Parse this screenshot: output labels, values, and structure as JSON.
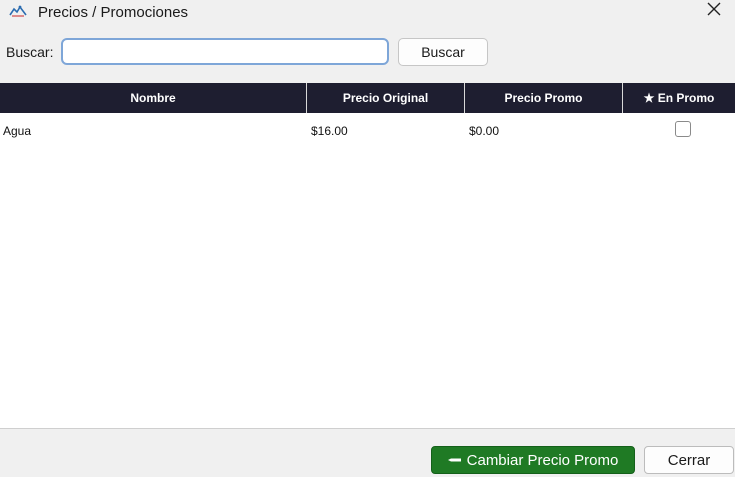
{
  "window": {
    "title": "Precios / Promociones",
    "app_icon": "app-logo-icon",
    "close_icon": "close-icon"
  },
  "search": {
    "label": "Buscar:",
    "value": "",
    "placeholder": "",
    "button_label": "Buscar"
  },
  "table": {
    "columns": {
      "nombre": "Nombre",
      "precio_original": "Precio Original",
      "precio_promo": "Precio Promo",
      "en_promo": "★ En Promo"
    },
    "rows": [
      {
        "nombre": "Agua",
        "precio_original": "$16.00",
        "precio_promo": "$0.00",
        "en_promo": false
      }
    ]
  },
  "footer": {
    "cambiar_label": "Cambiar Precio Promo",
    "cambiar_icon": "pencil-icon",
    "cerrar_label": "Cerrar"
  },
  "colors": {
    "header_bg": "#1e1e30",
    "primary_button": "#1f7a24",
    "input_focus_border": "#7ea6d8"
  }
}
